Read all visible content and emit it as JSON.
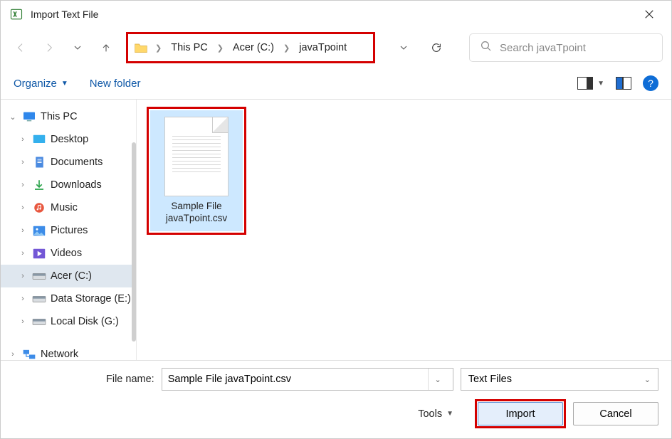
{
  "window": {
    "title": "Import Text File"
  },
  "nav": {
    "breadcrumbs": [
      "This PC",
      "Acer (C:)",
      "javaTpoint"
    ],
    "search_placeholder": "Search javaTpoint"
  },
  "toolbar": {
    "organize": "Organize",
    "new_folder": "New folder",
    "help": "?"
  },
  "sidebar": {
    "this_pc": "This PC",
    "items": [
      {
        "label": "Desktop"
      },
      {
        "label": "Documents"
      },
      {
        "label": "Downloads"
      },
      {
        "label": "Music"
      },
      {
        "label": "Pictures"
      },
      {
        "label": "Videos"
      },
      {
        "label": "Acer (C:)"
      },
      {
        "label": "Data Storage (E:)"
      },
      {
        "label": "Local Disk (G:)"
      }
    ],
    "network": "Network"
  },
  "files": {
    "selected": {
      "line1": "Sample File",
      "line2": "javaTpoint.csv"
    }
  },
  "footer": {
    "filename_label": "File name:",
    "filename_value": "Sample File javaTpoint.csv",
    "filter": "Text Files",
    "tools": "Tools",
    "import": "Import",
    "cancel": "Cancel"
  }
}
